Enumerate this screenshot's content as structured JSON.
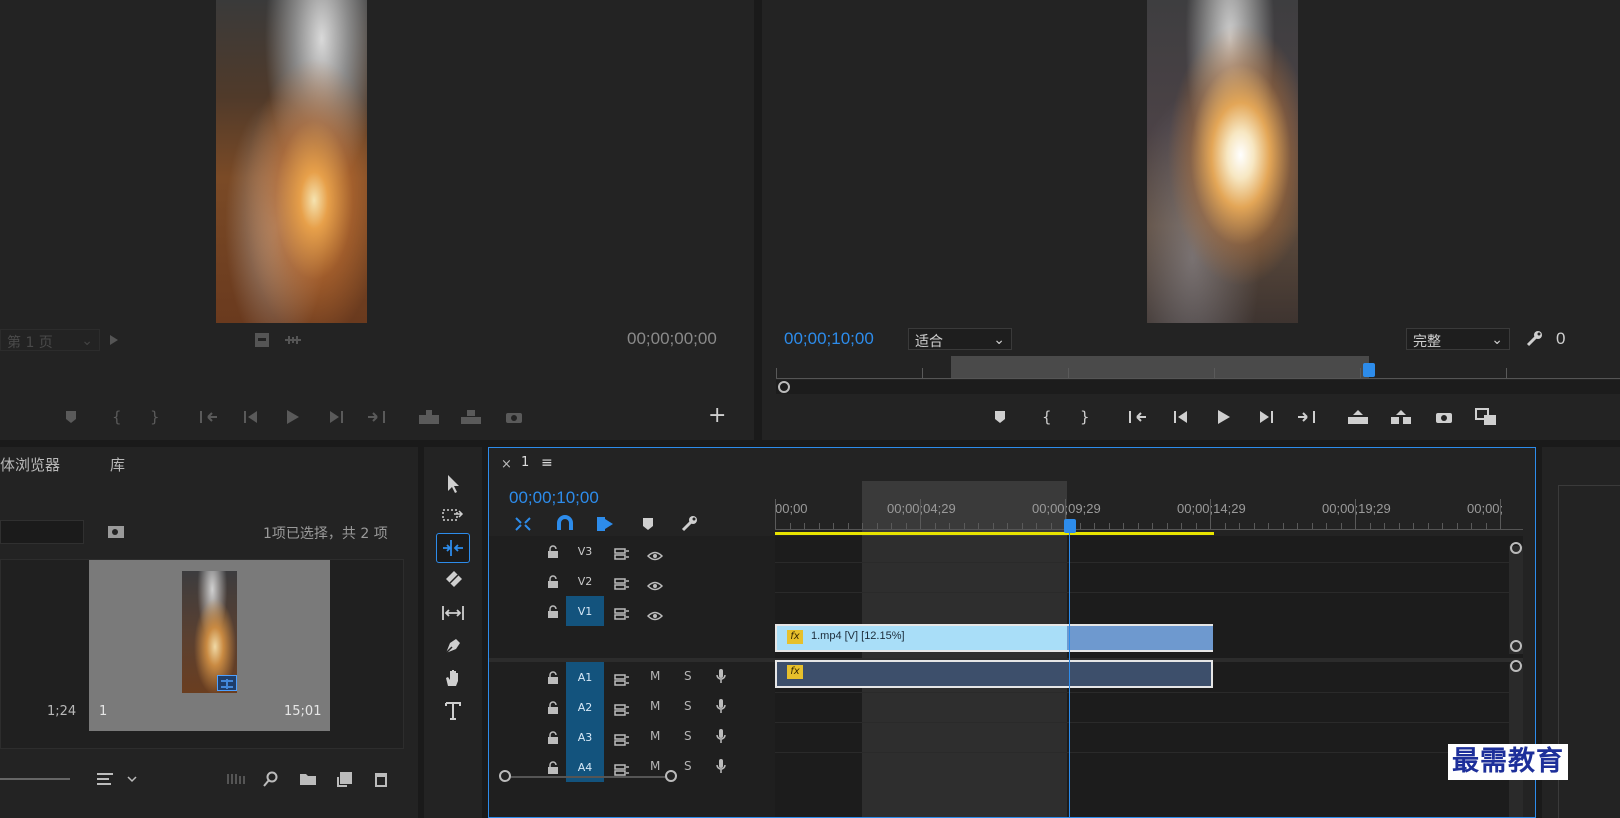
{
  "source_monitor": {
    "page_select": "第 1 页",
    "timecode": "00;00;00;00",
    "add_label": "+"
  },
  "program_monitor": {
    "timecode": "00;00;10;00",
    "fit_select": "适合",
    "quality_select": "完整",
    "overflow_digit": "0"
  },
  "project_panel": {
    "tab_media_browser": "体浏览器",
    "tab_library": "库",
    "selection_status": "1项已选择，共 2 项",
    "clip_left_duration": "1;24",
    "clip_name": "1",
    "clip_duration": "15;01"
  },
  "timeline": {
    "close_label": "×",
    "sequence_name": "1",
    "menu_label": "≡",
    "timecode": "00;00;10;00",
    "ruler_labels": [
      "00;00",
      "00;00;04;29",
      "00;00;09;29",
      "00;00;14;29",
      "00;00;19;29",
      "00;00;"
    ],
    "video_tracks": [
      "V3",
      "V2",
      "V1"
    ],
    "audio_tracks": [
      "A1",
      "A2",
      "A3",
      "A4"
    ],
    "mute_label": "M",
    "solo_label": "S",
    "video_clip_label": "1.mp4 [V] [12.15%]",
    "fx_label": "fx"
  },
  "watermark": "最需教育",
  "colors": {
    "accent_blue": "#2d8ceb",
    "video_clip": "#a9def8",
    "audio_clip": "#3d4f6b",
    "work_area": "#e8e400",
    "track_active": "#13537d"
  }
}
